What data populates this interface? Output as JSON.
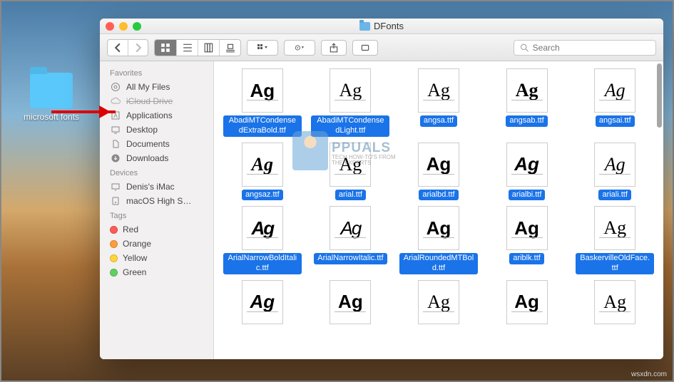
{
  "desktop": {
    "folder_label": "microsoft fonts"
  },
  "window": {
    "title": "DFonts",
    "search_placeholder": "Search"
  },
  "sidebar": {
    "favorites_header": "Favorites",
    "favorites": [
      {
        "label": "All My Files",
        "icon": "all-files"
      },
      {
        "label": "iCloud Drive",
        "icon": "cloud",
        "dim": true
      },
      {
        "label": "Applications",
        "icon": "apps"
      },
      {
        "label": "Desktop",
        "icon": "desktop"
      },
      {
        "label": "Documents",
        "icon": "documents"
      },
      {
        "label": "Downloads",
        "icon": "downloads"
      }
    ],
    "devices_header": "Devices",
    "devices": [
      {
        "label": "Denis's iMac",
        "icon": "imac"
      },
      {
        "label": "macOS High S…",
        "icon": "disk"
      }
    ],
    "tags_header": "Tags",
    "tags": [
      {
        "label": "Red",
        "color": "#ff5b55"
      },
      {
        "label": "Orange",
        "color": "#ff9c3c"
      },
      {
        "label": "Yellow",
        "color": "#ffd53c"
      },
      {
        "label": "Green",
        "color": "#60d160"
      }
    ]
  },
  "files": [
    {
      "name": "AbadiMTCondensedExtraBold.ttf",
      "style": "bold"
    },
    {
      "name": "AbadiMTCondensedLight.ttf",
      "style": ""
    },
    {
      "name": "angsa.ttf",
      "style": "serif"
    },
    {
      "name": "angsab.ttf",
      "style": "bold serif"
    },
    {
      "name": "angsai.ttf",
      "style": "italic serif"
    },
    {
      "name": "angsaz.ttf",
      "style": "bold italic serif"
    },
    {
      "name": "arial.ttf",
      "style": ""
    },
    {
      "name": "arialbd.ttf",
      "style": "bold"
    },
    {
      "name": "arialbi.ttf",
      "style": "bold italic"
    },
    {
      "name": "ariali.ttf",
      "style": "italic"
    },
    {
      "name": "ArialNarrowBoldItalic.ttf",
      "style": "bold italic narrow"
    },
    {
      "name": "ArialNarrowItalic.ttf",
      "style": "italic narrow"
    },
    {
      "name": "ArialRoundedMTBold.ttf",
      "style": "bold"
    },
    {
      "name": "ariblk.ttf",
      "style": "bold"
    },
    {
      "name": "BaskervilleOldFace.ttf",
      "style": "serif"
    },
    {
      "name": "",
      "style": "bold italic"
    },
    {
      "name": "",
      "style": "bold"
    },
    {
      "name": "",
      "style": ""
    },
    {
      "name": "",
      "style": "bold"
    },
    {
      "name": "",
      "style": "serif"
    }
  ],
  "watermark": {
    "brand": "PPUALS",
    "tag1": "TECH HOW-TO'S FROM",
    "tag2": "THE EXPERTS"
  },
  "credit": "wsxdn.com"
}
